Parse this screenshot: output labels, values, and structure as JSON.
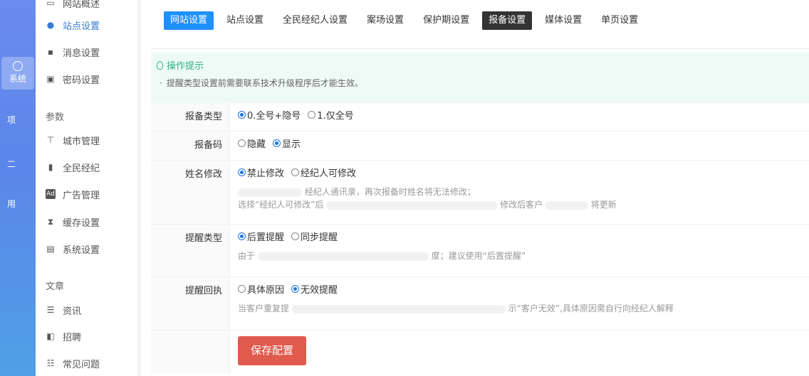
{
  "rail": {
    "active_label": "系统",
    "fragments": [
      "项",
      "二",
      "用"
    ]
  },
  "sidebar": {
    "items_top": [
      {
        "label": "网站概述",
        "icon": "monitor-icon"
      },
      {
        "label": "站点设置",
        "icon": "palette-icon",
        "active": true
      },
      {
        "label": "消息设置",
        "icon": "chat-icon"
      },
      {
        "label": "密码设置",
        "icon": "keyboard-icon"
      }
    ],
    "group_params": "参数",
    "items_params": [
      {
        "label": "城市管理",
        "icon": "sitemap-icon"
      },
      {
        "label": "全民经纪",
        "icon": "bookmark-icon"
      },
      {
        "label": "广告管理",
        "icon": "ad-icon"
      },
      {
        "label": "缓存设置",
        "icon": "hourglass-icon"
      },
      {
        "label": "系统设置",
        "icon": "card-icon"
      }
    ],
    "group_article": "文章",
    "items_article": [
      {
        "label": "资讯",
        "icon": "doc-icon"
      },
      {
        "label": "招聘",
        "icon": "panel-icon"
      },
      {
        "label": "常见问题",
        "icon": "list-icon"
      }
    ]
  },
  "tabs": [
    {
      "label": "网站设置",
      "state": "primary"
    },
    {
      "label": "站点设置"
    },
    {
      "label": "全民经纪人设置"
    },
    {
      "label": "案场设置"
    },
    {
      "label": "保护期设置"
    },
    {
      "label": "报备设置",
      "state": "active"
    },
    {
      "label": "媒体设置"
    },
    {
      "label": "单页设置"
    }
  ],
  "tip": {
    "title": "操作提示",
    "body": "提醒类型设置前需要联系技术升级程序后才能生效。"
  },
  "form": {
    "report_type": {
      "label": "报备类型",
      "options": [
        "0.全号+隐号",
        "1.仅全号"
      ],
      "selected": 0
    },
    "report_code": {
      "label": "报备码",
      "options": [
        "隐藏",
        "显示"
      ],
      "selected": 1
    },
    "name_edit": {
      "label": "姓名修改",
      "options": [
        "禁止修改",
        "经纪人可修改"
      ],
      "selected": 0,
      "hint_line1": "经纪人通讯录，再次报备时姓名将无法修改；",
      "hint_line2_a": "选择“经纪人可修改”后",
      "hint_line2_b": "修改后客户",
      "hint_line2_c": "将更新"
    },
    "remind_type": {
      "label": "提醒类型",
      "options": [
        "后置提醒",
        "同步提醒"
      ],
      "selected": 0,
      "hint_a": "由于",
      "hint_b": "度；建议使用“后置提醒”"
    },
    "remind_reply": {
      "label": "提醒回执",
      "options": [
        "具体原因",
        "无效提醒"
      ],
      "selected": 1,
      "hint_a": "当客户重复提",
      "hint_b": "示“客户无效”,具体原因需自行向经纪人解释"
    },
    "save_label": "保存配置"
  }
}
